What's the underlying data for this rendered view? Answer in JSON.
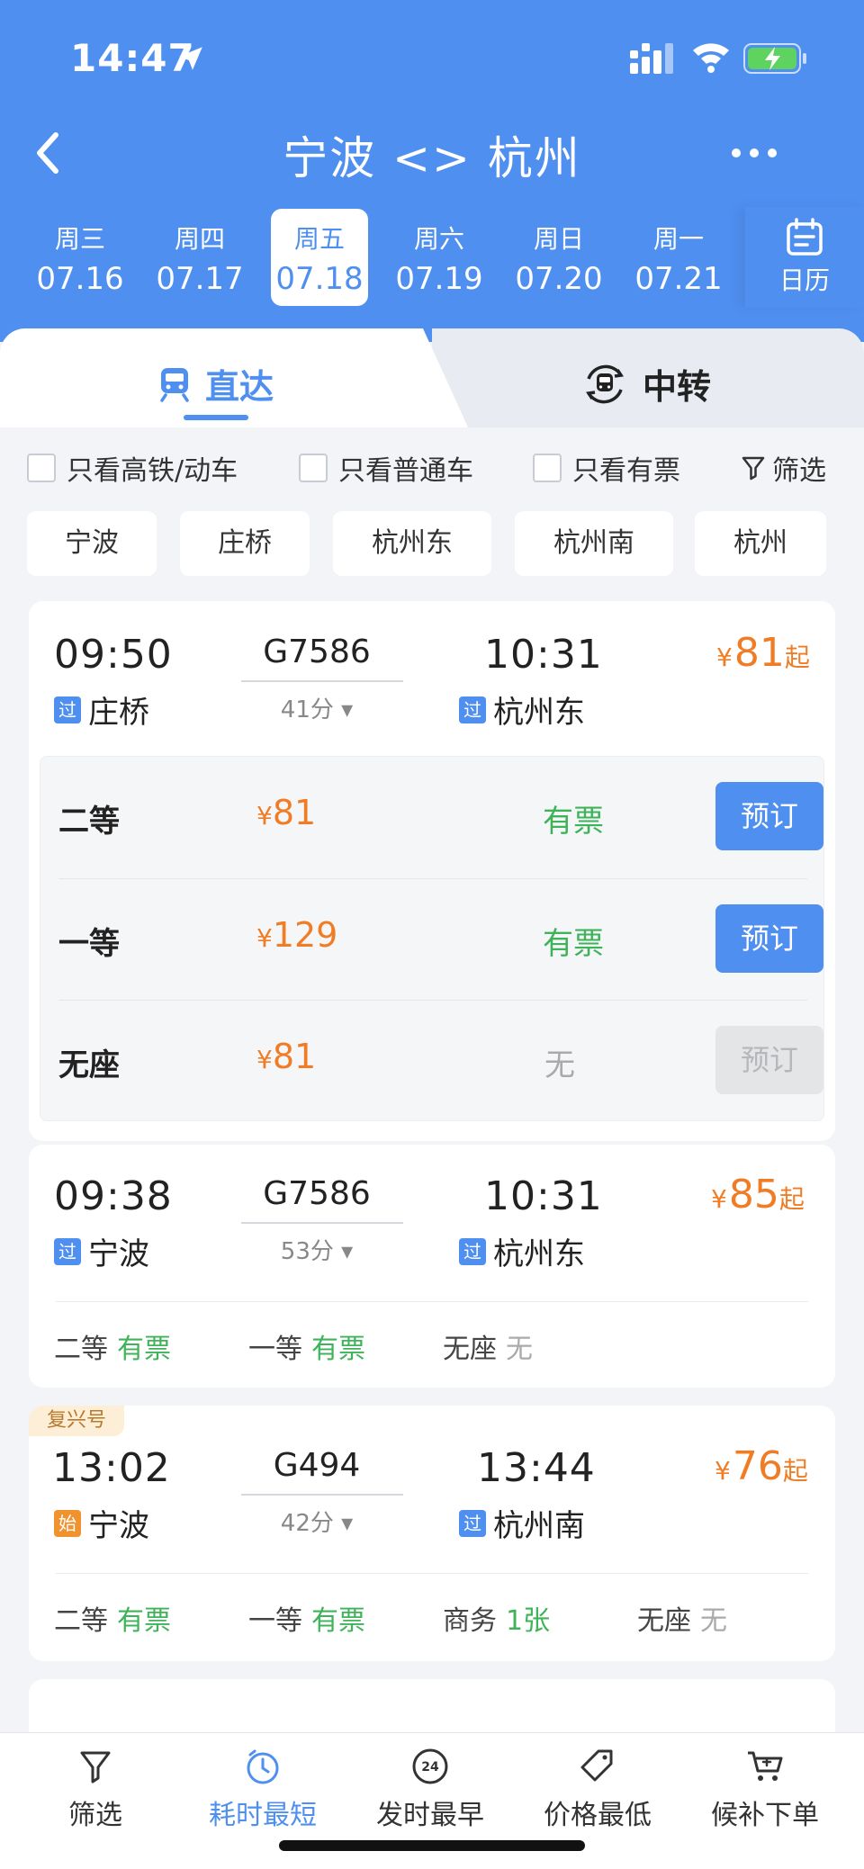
{
  "status": {
    "time": "14:47"
  },
  "nav": {
    "title": "宁波 <> 杭州"
  },
  "dates": [
    {
      "weekday": "周三",
      "date": "07.16"
    },
    {
      "weekday": "周四",
      "date": "07.17"
    },
    {
      "weekday": "周五",
      "date": "07.18",
      "active": true
    },
    {
      "weekday": "周六",
      "date": "07.19"
    },
    {
      "weekday": "周日",
      "date": "07.20"
    },
    {
      "weekday": "周一",
      "date": "07.21"
    }
  ],
  "calendar_label": "日历",
  "tabs": {
    "direct": "直达",
    "transfer": "中转"
  },
  "filters": {
    "high_speed": "只看高铁/动车",
    "normal": "只看普通车",
    "available": "只看有票",
    "filter": "筛选"
  },
  "stations": [
    "宁波",
    "庄桥",
    "杭州东",
    "杭州南",
    "杭州"
  ],
  "trains": [
    {
      "depart_time": "09:50",
      "code": "G7586",
      "duration": "41分",
      "arrive_time": "10:31",
      "from_tag": "过",
      "from": "庄桥",
      "to_tag": "过",
      "to": "杭州东",
      "price_yen": "¥",
      "price": "81",
      "price_suffix": "起",
      "seats": [
        {
          "name": "二等",
          "yen": "¥",
          "price": "81",
          "status": "有票",
          "button": "预订"
        },
        {
          "name": "一等",
          "yen": "¥",
          "price": "129",
          "status": "有票",
          "button": "预订"
        },
        {
          "name": "无座",
          "yen": "¥",
          "price": "81",
          "status": "无",
          "button": "预订"
        }
      ]
    },
    {
      "depart_time": "09:38",
      "code": "G7586",
      "duration": "53分",
      "arrive_time": "10:31",
      "from_tag": "过",
      "from": "宁波",
      "to_tag": "过",
      "to": "杭州东",
      "price_yen": "¥",
      "price": "85",
      "price_suffix": "起",
      "seat_summary": [
        {
          "name": "二等",
          "status": "有票"
        },
        {
          "name": "一等",
          "status": "有票"
        },
        {
          "name": "无座",
          "status": "无"
        }
      ]
    },
    {
      "badge": "复兴号",
      "depart_time": "13:02",
      "code": "G494",
      "duration": "42分",
      "arrive_time": "13:44",
      "from_tag": "始",
      "from": "宁波",
      "to_tag": "过",
      "to": "杭州南",
      "price_yen": "¥",
      "price": "76",
      "price_suffix": "起",
      "seat_summary": [
        {
          "name": "二等",
          "status": "有票"
        },
        {
          "name": "一等",
          "status": "有票"
        },
        {
          "name": "商务",
          "status": "1张"
        },
        {
          "name": "无座",
          "status": "无"
        }
      ]
    }
  ],
  "bottom_bar": [
    {
      "label": "筛选",
      "icon": "filter-icon"
    },
    {
      "label": "耗时最短",
      "icon": "timer-icon",
      "active": true
    },
    {
      "label": "发时最早",
      "icon": "clock-24-icon"
    },
    {
      "label": "价格最低",
      "icon": "price-tag-icon"
    },
    {
      "label": "候补下单",
      "icon": "cart-icon"
    }
  ],
  "colors": {
    "primary": "#4f8ff0",
    "price": "#f07d25",
    "available": "#3fb35a",
    "unavailable": "#aaaaaa"
  }
}
